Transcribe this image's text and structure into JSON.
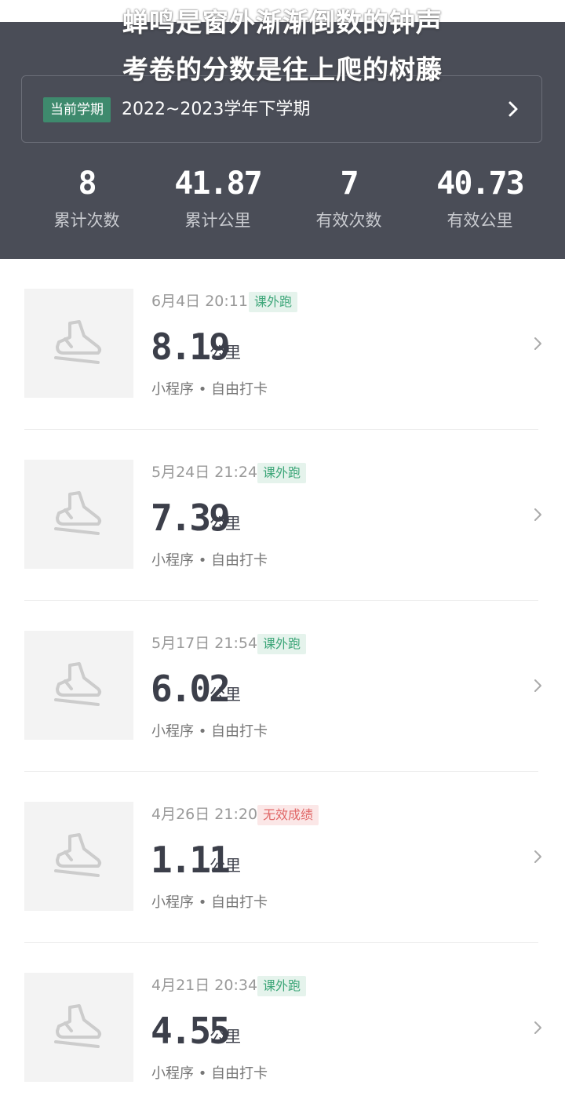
{
  "caption": {
    "line1": "蝉鸣是窗外渐渐倒数的钟声",
    "line2": "考卷的分数是往上爬的树藤"
  },
  "term": {
    "badge": "当前学期",
    "value": "2022~2023学年下学期",
    "chevron_icon": "chevron-right-icon"
  },
  "stats": [
    {
      "value": "8",
      "label": "累计次数"
    },
    {
      "value": "41.87",
      "label": "累计公里"
    },
    {
      "value": "7",
      "label": "有效次数"
    },
    {
      "value": "40.73",
      "label": "有效公里"
    }
  ],
  "records": [
    {
      "time": "6月4日 20:11",
      "tag": "课外跑",
      "tag_type": "ok",
      "distance": "8.19",
      "unit": "公里",
      "source": "小程序 • 自由打卡"
    },
    {
      "time": "5月24日 21:24",
      "tag": "课外跑",
      "tag_type": "ok",
      "distance": "7.39",
      "unit": "公里",
      "source": "小程序 • 自由打卡"
    },
    {
      "time": "5月17日 21:54",
      "tag": "课外跑",
      "tag_type": "ok",
      "distance": "6.02",
      "unit": "公里",
      "source": "小程序 • 自由打卡"
    },
    {
      "time": "4月26日 21:20",
      "tag": "无效成绩",
      "tag_type": "bad",
      "distance": "1.11",
      "unit": "公里",
      "source": "小程序 • 自由打卡"
    },
    {
      "time": "4月21日 20:34",
      "tag": "课外跑",
      "tag_type": "ok",
      "distance": "4.55",
      "unit": "公里",
      "source": "小程序 • 自由打卡"
    }
  ],
  "colors": {
    "header_bg": "#4a4d57",
    "badge_green": "#3e8a6d",
    "tag_ok_text": "#3fa77a",
    "tag_bad_text": "#e06666"
  }
}
